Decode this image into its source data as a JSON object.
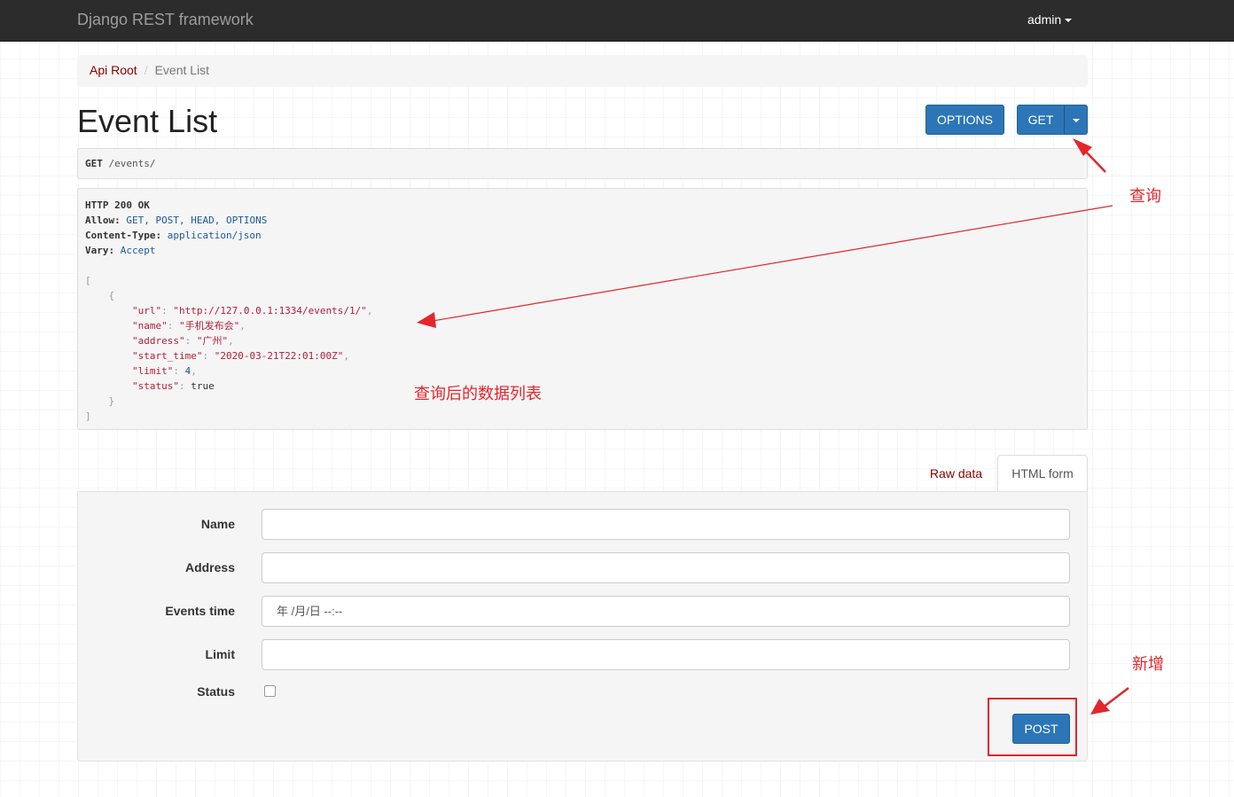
{
  "navbar": {
    "brand": "Django REST framework",
    "user": "admin"
  },
  "breadcrumb": {
    "root": "Api Root",
    "sep": "/",
    "current": "Event List"
  },
  "page": {
    "title": "Event List"
  },
  "buttons": {
    "options": "OPTIONS",
    "get": "GET",
    "post": "POST"
  },
  "request": {
    "method": "GET",
    "path": "/events/"
  },
  "response": {
    "status_line": "HTTP 200 OK",
    "headers": [
      {
        "name": "Allow:",
        "value": "GET, POST, HEAD, OPTIONS"
      },
      {
        "name": "Content-Type:",
        "value": "application/json"
      },
      {
        "name": "Vary:",
        "value": "Accept"
      }
    ],
    "open_bracket": "[",
    "open_brace": "{",
    "fields": [
      {
        "key": "\"url\"",
        "value": "\"http://127.0.0.1:1334/events/1/\"",
        "comma": ","
      },
      {
        "key": "\"name\"",
        "value": "\"手机发布会\"",
        "comma": ","
      },
      {
        "key": "\"address\"",
        "value": "\"广州\"",
        "comma": ","
      },
      {
        "key": "\"start_time\"",
        "value": "\"2020-03-21T22:01:00Z\"",
        "comma": ","
      },
      {
        "key": "\"limit\"",
        "value": "4",
        "comma": ","
      },
      {
        "key": "\"status\"",
        "value": "true",
        "comma": ""
      }
    ],
    "close_brace": "}",
    "close_bracket": "]"
  },
  "tabs": {
    "raw": "Raw data",
    "html": "HTML form"
  },
  "form": {
    "name_label": "Name",
    "address_label": "Address",
    "events_time_label": "Events time",
    "events_time_value": "年 /月/日  --:--",
    "limit_label": "Limit",
    "status_label": "Status"
  },
  "annotations": {
    "query": "查询",
    "query_result": "查询后的数据列表",
    "add": "新增"
  },
  "colors": {
    "navbar": "#2c2c2c",
    "primary": "#2c76b7",
    "link": "#8b0000",
    "annotation": "#e3262c"
  }
}
